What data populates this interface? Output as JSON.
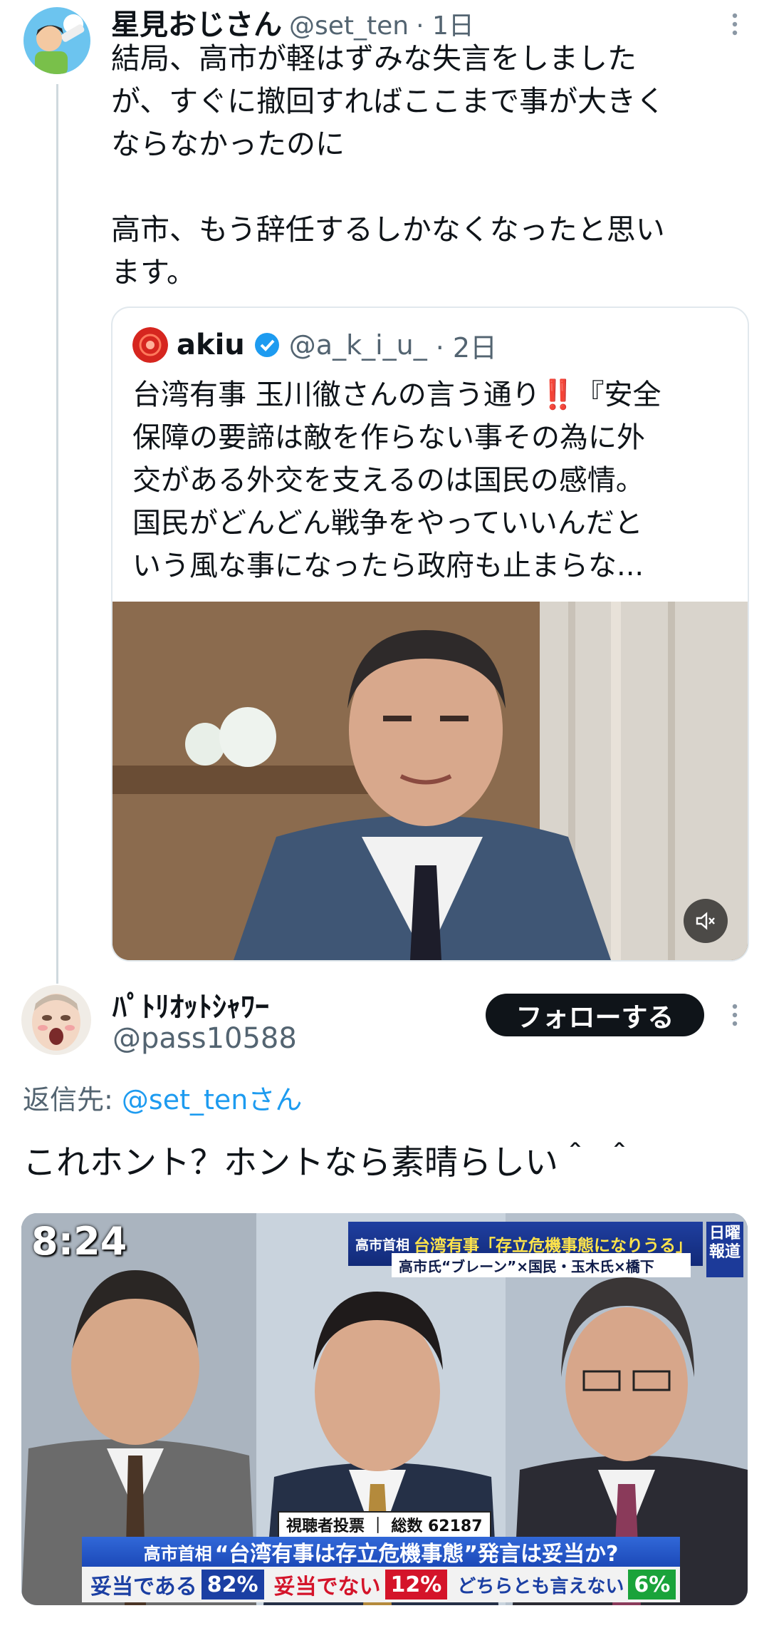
{
  "tweet1": {
    "name": "星見おじさん",
    "handle": "@set_ten",
    "time": "· 1日",
    "text": "結局、高市が軽はずみな失言をしました\nが、すぐに撤回すればここまで事が大きく\nならなかったのに\n\n高市、もう辞任するしかなくなったと思い\nます。",
    "more_icon": "more-vertical-icon"
  },
  "quote": {
    "name": "akiu",
    "handle": "@a_k_i_u_",
    "time": "· 2日",
    "text": "台湾有事 玉川徹さんの言う通り‼️『安全\n保障の要諦は敵を作らない事その為に外\n交がある外交を支えるのは国民の感情。\n国民がどんどん戦争をやっていいんだと\nいう風な事になったら政府も止まらな...",
    "verified_icon": "verified-badge-icon",
    "mute_icon": "volume-muted-icon",
    "avatar_color": "#d6261f"
  },
  "tweet2": {
    "name": "ﾊﾟﾄﾘｵｯﾄｼｬﾜｰ",
    "handle": "@pass10588",
    "follow_label": "フォローする",
    "reply_to_prefix": "返信先: ",
    "reply_to_handle": "@set_tenさん",
    "text": "これホント？ホントなら素晴らしい＾ ＾"
  },
  "tv_image": {
    "clock": "8:24",
    "banner_prefix": "高市首相",
    "banner_main": "台湾有事「存立危機事態になりうる」",
    "banner_sub": "高市氏“ブレーン”×国民・玉木氏×橋下",
    "logo": "日曜\n報道",
    "poll_label": "視聴者投票 ｜ 総数 62187",
    "question_prefix": "高市首相",
    "question_main": "“台湾有事は存立危機事態”発言は妥当か?",
    "result_a_label": "妥当である",
    "result_a_value": "82%",
    "result_b_label": "妥当でない",
    "result_b_value": "12%",
    "result_c_label": "どちらとも言えない",
    "result_c_value": "6%"
  },
  "colors": {
    "accent": "#1d9bf0",
    "text": "#0f1419",
    "muted": "#536471"
  }
}
